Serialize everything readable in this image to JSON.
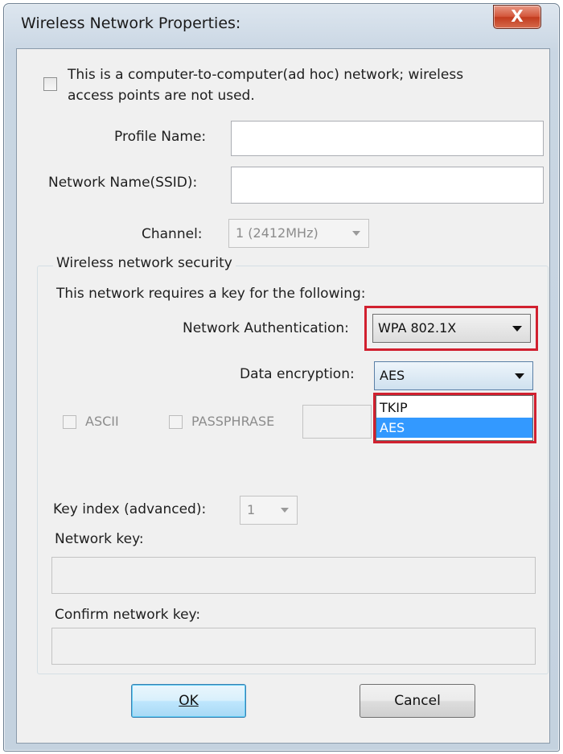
{
  "window": {
    "title": "Wireless Network Properties:",
    "close_glyph": "X"
  },
  "adhoc": {
    "label_line1": "This is a computer-to-computer(ad hoc) network; wireless",
    "label_line2": "access points are not used.",
    "checked": false
  },
  "profile": {
    "label": "Profile Name:",
    "value": ""
  },
  "ssid": {
    "label": "Network Name(SSID):",
    "value": ""
  },
  "channel": {
    "label": "Channel:",
    "value": "1  (2412MHz)"
  },
  "security": {
    "group_title": "Wireless network security",
    "requires_text": "This network requires a key for the following:",
    "auth_label": "Network Authentication:",
    "auth_value": "WPA 802.1X",
    "enc_label": "Data encryption:",
    "enc_value": "AES",
    "enc_options": [
      "TKIP",
      "AES"
    ],
    "enc_selected": "AES",
    "ascii_label": "ASCII",
    "passphrase_label": "PASSPHRASE",
    "key_index_label": "Key index (advanced):",
    "key_index_value": "1",
    "network_key_label": "Network key:",
    "confirm_key_label": "Confirm network key:"
  },
  "buttons": {
    "ok": "OK",
    "cancel": "Cancel"
  },
  "colors": {
    "highlight_red": "#d1202f",
    "selection_blue": "#3399ff"
  }
}
